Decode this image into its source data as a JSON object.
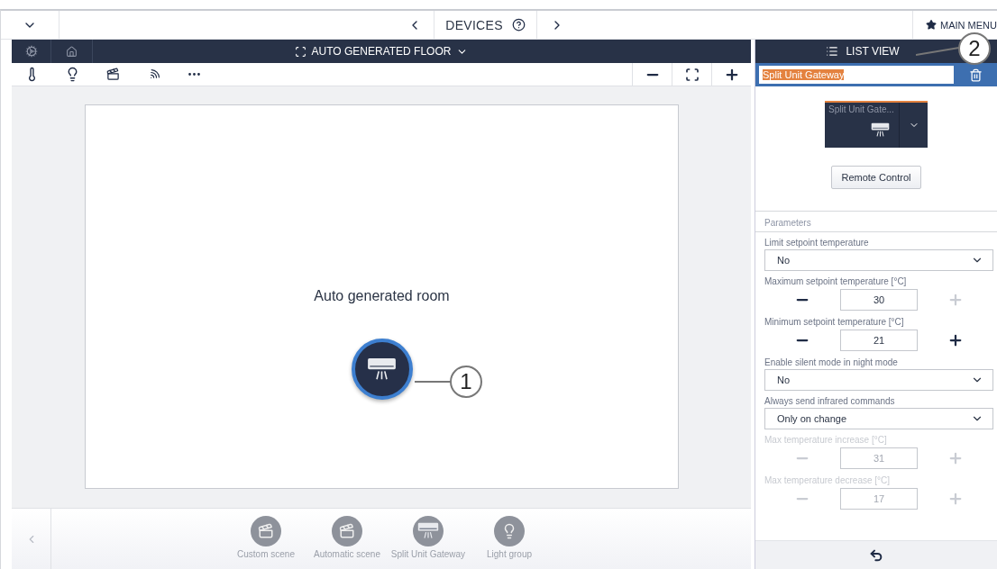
{
  "top_bar": {
    "title": "DEVICES",
    "main_menu": "MAIN MENU"
  },
  "floor_header": {
    "title": "AUTO GENERATED FLOOR"
  },
  "room": {
    "name": "Auto generated room"
  },
  "device_palette": [
    {
      "label": "Custom scene",
      "kind": "scene"
    },
    {
      "label": "Automatic scene",
      "kind": "scene"
    },
    {
      "label": "Split Unit Gateway",
      "kind": "ac"
    },
    {
      "label": "Light group",
      "kind": "light"
    }
  ],
  "list_view": {
    "title": "LIST VIEW",
    "name_value": "Split Unit Gateway",
    "tile_label": "Split Unit Gate...",
    "remote_button": "Remote Control"
  },
  "parameters": {
    "title": "Parameters",
    "items": [
      {
        "kind": "select",
        "label": "Limit setpoint temperature",
        "value": "No",
        "disabled": false
      },
      {
        "kind": "stepper",
        "label": "Maximum setpoint temperature [°C]",
        "value": "30",
        "disabled": false,
        "minus_enabled": true,
        "plus_enabled": false
      },
      {
        "kind": "stepper",
        "label": "Minimum setpoint temperature [°C]",
        "value": "21",
        "disabled": false,
        "minus_enabled": true,
        "plus_enabled": true
      },
      {
        "kind": "select",
        "label": "Enable silent mode in night mode",
        "value": "No",
        "disabled": false
      },
      {
        "kind": "select",
        "label": "Always send infrared commands",
        "value": "Only on change",
        "disabled": false
      },
      {
        "kind": "stepper",
        "label": "Max temperature increase [°C]",
        "value": "31",
        "disabled": true,
        "minus_enabled": false,
        "plus_enabled": false
      },
      {
        "kind": "stepper",
        "label": "Max temperature decrease [°C]",
        "value": "17",
        "disabled": true,
        "minus_enabled": false,
        "plus_enabled": false
      }
    ]
  },
  "callouts": [
    {
      "label": "1"
    },
    {
      "label": "2"
    }
  ]
}
